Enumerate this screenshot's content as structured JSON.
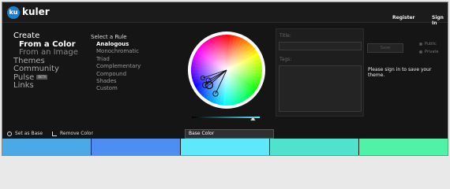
{
  "header": {
    "logo_badge": "ku",
    "logo_text": "kuler",
    "register": "Register",
    "signin": "Sign In"
  },
  "nav": {
    "items": [
      {
        "label": "Create",
        "style": "top"
      },
      {
        "label": "From a Color",
        "style": "sel"
      },
      {
        "label": "From an Image",
        "style": "sub"
      },
      {
        "label": "Themes",
        "style": "main"
      },
      {
        "label": "Community",
        "style": "main"
      },
      {
        "label": "Pulse",
        "style": "main"
      },
      {
        "label": "Links",
        "style": "main"
      }
    ],
    "beta_badge": "BETA"
  },
  "rules": {
    "title": "Select a Rule",
    "items": [
      "Analogous",
      "Monochromatic",
      "Triad",
      "Complementary",
      "Compound",
      "Shades",
      "Custom"
    ],
    "selected": "Analogous"
  },
  "form": {
    "title_label": "Title:",
    "tags_label": "Tags:",
    "save_label": "Save",
    "public_label": "Public",
    "private_label": "Private",
    "signin_message": "Please sign in to save your theme."
  },
  "toolbar": {
    "set_base": "Set as Base",
    "remove_color": "Remove Color",
    "base_color_tab": "Base Color"
  },
  "swatches": [
    {
      "color": "#4aa9e6"
    },
    {
      "color": "#4d8ef2"
    },
    {
      "color": "#5de9fb"
    },
    {
      "color": "#4fe2cd"
    },
    {
      "color": "#4ff3a8"
    }
  ],
  "brightness": {
    "value": 0.93
  }
}
